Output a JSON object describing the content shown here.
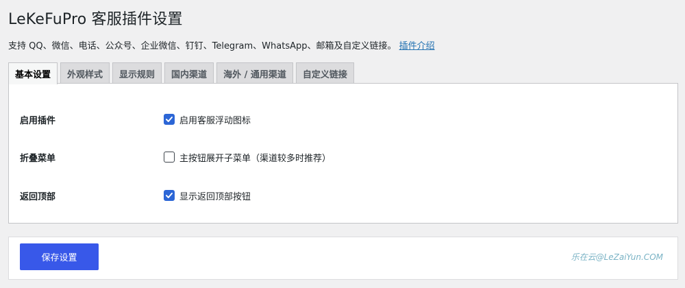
{
  "page": {
    "title": "LeKeFuPro 客服插件设置",
    "description": "支持 QQ、微信、电话、公众号、企业微信、钉钉、Telegram、WhatsApp、邮箱及自定义链接。",
    "intro_link": "插件介绍"
  },
  "tabs": [
    {
      "label": "基本设置",
      "active": true
    },
    {
      "label": "外观样式",
      "active": false
    },
    {
      "label": "显示规则",
      "active": false
    },
    {
      "label": "国内渠道",
      "active": false
    },
    {
      "label": "海外 / 通用渠道",
      "active": false
    },
    {
      "label": "自定义链接",
      "active": false
    }
  ],
  "settings": [
    {
      "label": "启用插件",
      "option": "启用客服浮动图标",
      "checked": true
    },
    {
      "label": "折叠菜单",
      "option": "主按钮展开子菜单（渠道较多时推荐）",
      "checked": false
    },
    {
      "label": "返回顶部",
      "option": "显示返回顶部按钮",
      "checked": true
    }
  ],
  "footer": {
    "save_label": "保存设置",
    "brand": "乐在云@LeZaiYun.COM"
  },
  "colors": {
    "accent": "#3858e9",
    "checkbox": "#2c66d6",
    "link": "#2271b1",
    "brand": "#7ab3c5"
  }
}
